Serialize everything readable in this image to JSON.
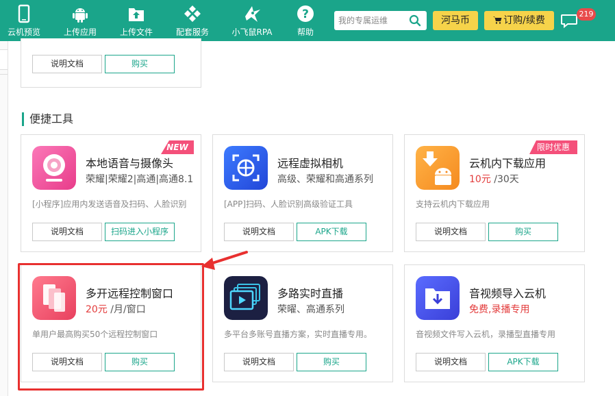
{
  "nav": [
    {
      "label": "云机预览",
      "icon": "phone-icon"
    },
    {
      "label": "上传应用",
      "icon": "android-icon"
    },
    {
      "label": "上传文件",
      "icon": "upload-file-icon"
    },
    {
      "label": "配套服务",
      "icon": "diamond-grid-icon"
    },
    {
      "label": "小飞鼠RPA",
      "icon": "flying-squirrel-icon"
    },
    {
      "label": "帮助",
      "icon": "help-icon"
    }
  ],
  "search": {
    "placeholder": "我的专属运维"
  },
  "buttons": {
    "coin": "河马币",
    "order": "订购/续费"
  },
  "notifications": {
    "count": "219"
  },
  "colors": {
    "primary": "#1aa58a",
    "yellow": "#f6d34a",
    "red": "#e33c3c",
    "badge": "#e84a4a"
  },
  "section_title": "便捷工具",
  "top_partial": {
    "btn1": "说明文档",
    "btn2": "购买"
  },
  "cards": [
    {
      "title": "本地语音与摄像头",
      "sub": "荣耀|荣耀2|高通|高通8.1",
      "desc": "[小程序]应用内发送语音及扫码、人脸识别",
      "btn1": "说明文档",
      "btn2": "扫码进入小程序",
      "tag": "NEW",
      "icon": "webcam-icon"
    },
    {
      "title": "远程虚拟相机",
      "sub": "高级、荣耀和高通系列",
      "desc": "[APP]扫码、人脸识别高级验证工具",
      "btn1": "说明文档",
      "btn2": "APK下载",
      "icon": "virtual-camera-icon"
    },
    {
      "title": "云机内下载应用",
      "sub_price": "10元",
      "sub_unit": " /30天",
      "desc": "支持云机内下载应用",
      "btn1": "说明文档",
      "btn2": "购买",
      "tag": "限时优惠",
      "icon": "android-download-icon"
    },
    {
      "title": "多开远程控制窗口",
      "sub_price": "20元",
      "sub_unit": " /月/窗口",
      "desc": "单用户最高购买50个远程控制窗口",
      "btn1": "说明文档",
      "btn2": "购买",
      "icon": "multi-window-icon"
    },
    {
      "title": "多路实时直播",
      "sub": "荣曜、高通系列",
      "desc": "多平台多账号直播方案，实时直播专用。",
      "btn1": "说明文档",
      "btn2": "购买",
      "icon": "live-stream-icon"
    },
    {
      "title": "音视频导入云机",
      "sub_price": "免费,录播专用",
      "desc": "音视频文件写入云机，录播型直播专用",
      "btn1": "说明文档",
      "btn2": "APK下载",
      "icon": "media-import-icon"
    }
  ]
}
